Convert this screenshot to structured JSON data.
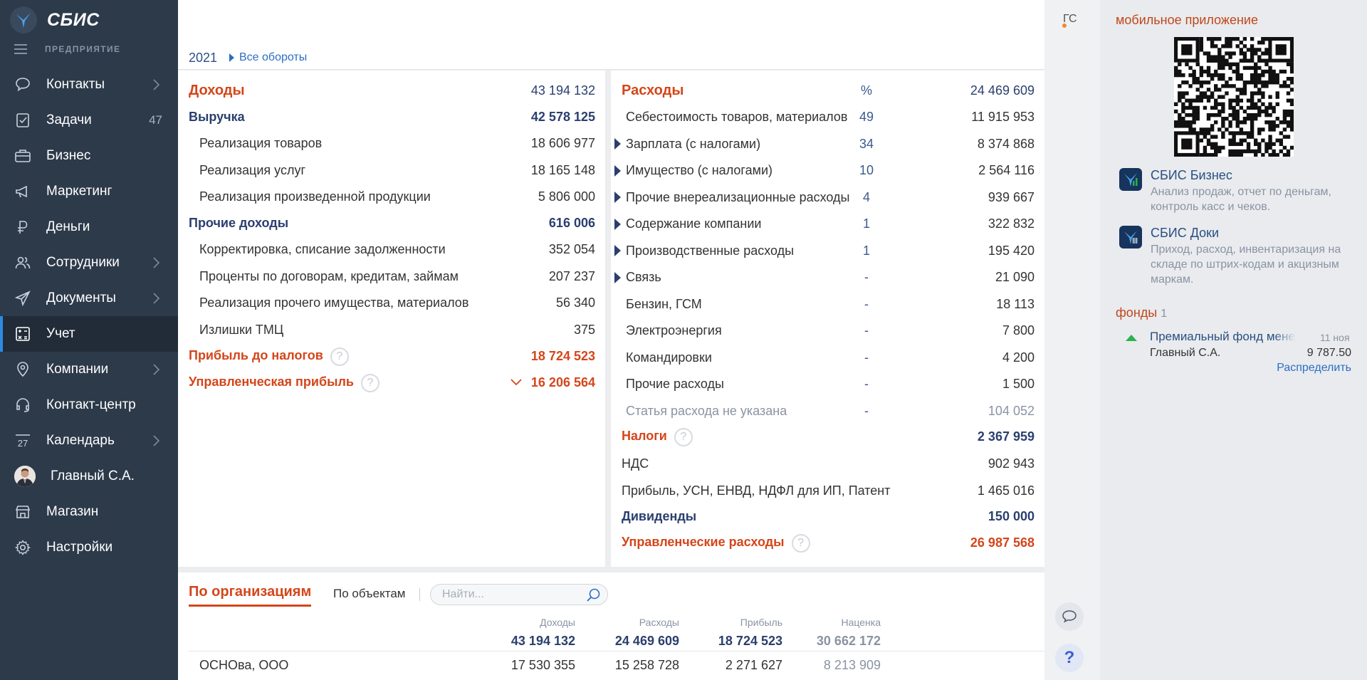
{
  "app": {
    "brand": "СБИС",
    "section": "ПРЕДПРИЯТИЕ"
  },
  "menu": [
    {
      "label": "Контакты",
      "icon": "chat-icon",
      "arrow": true
    },
    {
      "label": "Задачи",
      "icon": "task-icon",
      "badge": "47"
    },
    {
      "label": "Бизнес",
      "icon": "briefcase-icon"
    },
    {
      "label": "Маркетинг",
      "icon": "megaphone-icon"
    },
    {
      "label": "Деньги",
      "icon": "ruble-icon"
    },
    {
      "label": "Сотрудники",
      "icon": "people-icon",
      "arrow": true
    },
    {
      "label": "Документы",
      "icon": "paper-plane-icon",
      "arrow": true
    },
    {
      "label": "Учет",
      "icon": "calculator-icon",
      "active": true
    },
    {
      "label": "Компании",
      "icon": "location-icon",
      "arrow": true
    },
    {
      "label": "Контакт-центр",
      "icon": "headset-icon"
    },
    {
      "label": "Календарь",
      "icon": "calendar-icon",
      "arrow": true,
      "iconText": "27"
    },
    {
      "label": "Главный С.А.",
      "icon": "avatar"
    },
    {
      "label": "Магазин",
      "icon": "shop-icon"
    },
    {
      "label": "Настройки",
      "icon": "gear-icon"
    }
  ],
  "header": {
    "year": "2021",
    "all_link": "Все обороты"
  },
  "income": {
    "title": "Доходы",
    "total": "43 194 132",
    "revenue": {
      "label": "Выручка",
      "value": "42 578 125"
    },
    "revenue_items": [
      {
        "label": "Реализация товаров",
        "value": "18 606 977"
      },
      {
        "label": "Реализация услуг",
        "value": "18 165 148"
      },
      {
        "label": "Реализация произведенной продукции",
        "value": "5 806 000"
      }
    ],
    "other": {
      "label": "Прочие доходы",
      "value": "616 006"
    },
    "other_items": [
      {
        "label": "Корректировка, списание задолженности",
        "value": "352 054"
      },
      {
        "label": "Проценты по договорам, кредитам, займам",
        "value": "207 237"
      },
      {
        "label": "Реализация прочего имущества, материалов",
        "value": "56 340"
      },
      {
        "label": "Излишки ТМЦ",
        "value": "375"
      }
    ],
    "profit_before_tax": {
      "label": "Прибыль до налогов",
      "value": "18 724 523"
    },
    "mgmt_profit": {
      "label": "Управленческая прибыль",
      "value": "16 206 564"
    }
  },
  "expenses": {
    "title": "Расходы",
    "pct_header": "%",
    "total": "24 469 609",
    "items": [
      {
        "label": "Себестоимость товаров, материалов",
        "pct": "49",
        "value": "11 915 953",
        "expand": false
      },
      {
        "label": "Зарплата (с налогами)",
        "pct": "34",
        "value": "8 374 868",
        "expand": true
      },
      {
        "label": "Имущество (с налогами)",
        "pct": "10",
        "value": "2 564 116",
        "expand": true
      },
      {
        "label": "Прочие внереализационные расходы",
        "pct": "4",
        "value": "939 667",
        "expand": true
      },
      {
        "label": "Содержание компании",
        "pct": "1",
        "value": "322 832",
        "expand": true
      },
      {
        "label": "Производственные расходы",
        "pct": "1",
        "value": "195 420",
        "expand": true
      },
      {
        "label": "Связь",
        "pct": "-",
        "value": "21 090",
        "expand": true
      },
      {
        "label": "Бензин, ГСМ",
        "pct": "-",
        "value": "18 113",
        "expand": false
      },
      {
        "label": "Электроэнергия",
        "pct": "-",
        "value": "7 800",
        "expand": false
      },
      {
        "label": "Командировки",
        "pct": "-",
        "value": "4 200",
        "expand": false
      },
      {
        "label": "Прочие расходы",
        "pct": "-",
        "value": "1 500",
        "expand": false
      },
      {
        "label": "Статья расхода не указана",
        "pct": "-",
        "value": "104 052",
        "expand": false,
        "muted": true
      }
    ],
    "taxes": {
      "label": "Налоги",
      "value": "2 367 959"
    },
    "tax_items": [
      {
        "label": "НДС",
        "value": "902 943"
      },
      {
        "label": "Прибыль, УСН, ЕНВД, НДФЛ для ИП, Патент",
        "value": "1 465 016"
      }
    ],
    "dividends": {
      "label": "Дивиденды",
      "value": "150 000"
    },
    "mgmt_expenses": {
      "label": "Управленческие расходы",
      "value": "26 987 568"
    }
  },
  "bottom": {
    "tab_active": "По организациям",
    "tab_other": "По объектам",
    "search_placeholder": "Найти...",
    "columns": [
      {
        "label": "Доходы",
        "total": "43 194 132"
      },
      {
        "label": "Расходы",
        "total": "24 469 609"
      },
      {
        "label": "Прибыль",
        "total": "18 724 523"
      },
      {
        "label": "Наценка",
        "total": "30 662 172"
      }
    ],
    "rows": [
      {
        "name": "ОСНОва, ООО",
        "values": [
          "17 530 355",
          "15 258 728",
          "2 271 627",
          "8 213 909"
        ]
      }
    ]
  },
  "right": {
    "user_initials": "ГС",
    "mobile_title": "мобильное приложение",
    "apps": [
      {
        "name": "СБИС Бизнес",
        "desc": "Анализ продаж, отчет по деньгам, контроль касс и чеков."
      },
      {
        "name": "СБИС Доки",
        "desc": "Приход, расход, инвентаризация на складе по штрих-кодам и акцизным маркам."
      }
    ],
    "funds_title": "фонды",
    "funds_count": "1",
    "fund": {
      "name": "Премиальный фонд менеджеров",
      "date": "11 ноя",
      "person": "Главный С.А.",
      "amount": "9 787.50",
      "action": "Распределить"
    }
  },
  "colors": {
    "sidebar": "#2d3a4a",
    "accent_orange": "#d4461a",
    "accent_blue": "#2a3f6e",
    "link": "#2c6ec2"
  }
}
